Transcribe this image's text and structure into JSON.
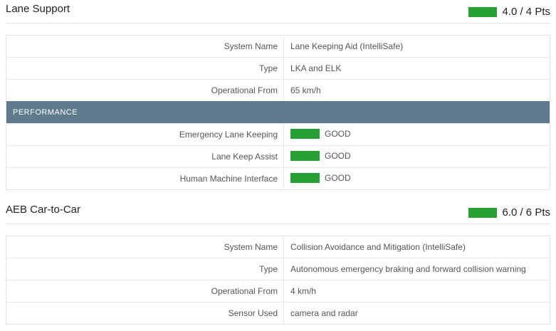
{
  "lane_support": {
    "title": "Lane Support",
    "score": "4.0 / 4 Pts",
    "colors": {
      "bar": "#27a033"
    },
    "rows": [
      {
        "label": "System Name",
        "value": "Lane Keeping Aid (IntelliSafe)"
      },
      {
        "label": "Type",
        "value": "LKA and ELK"
      },
      {
        "label": "Operational From",
        "value": "65 km/h"
      }
    ],
    "performance": {
      "heading": "PERFORMANCE",
      "rows": [
        {
          "label": "Emergency Lane Keeping",
          "rating": "GOOD"
        },
        {
          "label": "Lane Keep Assist",
          "rating": "GOOD"
        },
        {
          "label": "Human Machine Interface",
          "rating": "GOOD"
        }
      ]
    }
  },
  "aeb_car_to_car": {
    "title": "AEB Car-to-Car",
    "score": "6.0 / 6 Pts",
    "rows": [
      {
        "label": "System Name",
        "value": "Collision Avoidance and Mitigation (IntelliSafe)"
      },
      {
        "label": "Type",
        "value": "Autonomous emergency braking and forward collision warning"
      },
      {
        "label": "Operational From",
        "value": "4 km/h"
      },
      {
        "label": "Sensor Used",
        "value": "camera and radar"
      }
    ]
  },
  "theme": {
    "header_bg": "#5e7b8e",
    "good": "#27a033"
  }
}
